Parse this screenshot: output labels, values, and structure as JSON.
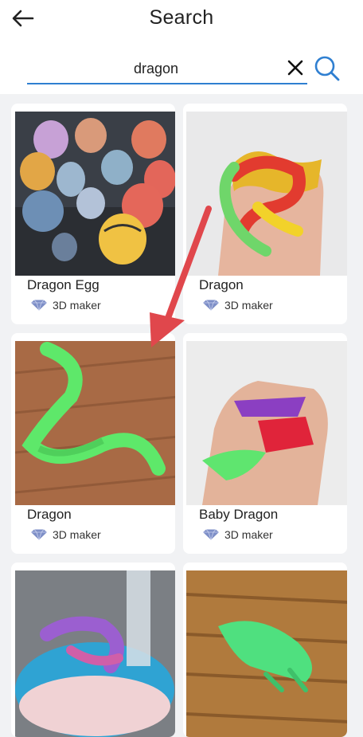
{
  "header": {
    "title": "Search",
    "back_icon": "back-arrow-icon"
  },
  "search": {
    "value": "dragon",
    "clear_icon": "close-icon",
    "search_icon": "search-icon",
    "accent_color": "#2f7fd1"
  },
  "results": [
    {
      "title": "Dragon Egg",
      "badge": "3D maker",
      "badge_icon": "diamond-icon"
    },
    {
      "title": "Dragon",
      "badge": "3D maker",
      "badge_icon": "diamond-icon"
    },
    {
      "title": "Dragon",
      "badge": "3D maker",
      "badge_icon": "diamond-icon"
    },
    {
      "title": "Baby Dragon",
      "badge": "3D maker",
      "badge_icon": "diamond-icon"
    },
    {
      "title": "",
      "badge": "",
      "badge_icon": ""
    },
    {
      "title": "",
      "badge": "",
      "badge_icon": ""
    }
  ],
  "annotation": {
    "arrow_color": "#e0474c"
  }
}
